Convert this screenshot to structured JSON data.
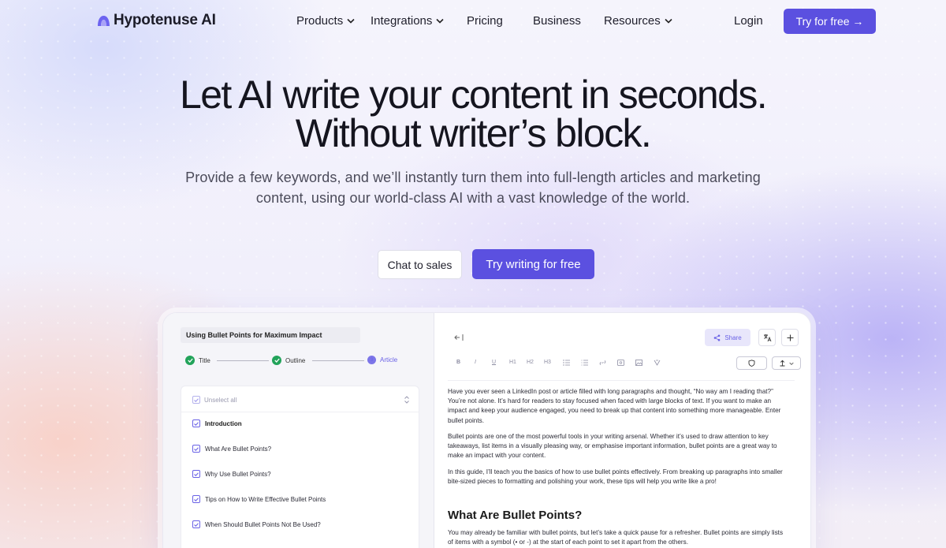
{
  "nav": {
    "brand": "Hypotenuse AI",
    "items": [
      {
        "label": "Products",
        "dropdown": true
      },
      {
        "label": "Integrations",
        "dropdown": true
      },
      {
        "label": "Pricing",
        "dropdown": false
      },
      {
        "label": "Business",
        "dropdown": false
      },
      {
        "label": "Resources",
        "dropdown": true
      }
    ],
    "login": "Login",
    "cta": "Try for free →"
  },
  "hero": {
    "headline_line1": "Let AI write your content in seconds.",
    "headline_line2": "Without writer’s block.",
    "sub_line1": "Provide a few keywords, and we’ll instantly turn them into full-length articles and marketing",
    "sub_line2": "content, using our world-class AI with a vast knowledge of the world.",
    "btn_sales": "Chat to sales",
    "btn_try": "Try writing for free"
  },
  "mockup": {
    "doc_title": "Using Bullet Points for Maximum Impact",
    "steps": [
      {
        "label": "Title",
        "state": "done"
      },
      {
        "label": "Outline",
        "state": "done"
      },
      {
        "label": "Article",
        "state": "active",
        "number": "3"
      }
    ],
    "outline_header": "Unselect all",
    "outline_items": [
      {
        "label": "Introduction",
        "bold": true
      },
      {
        "label": "What Are Bullet Points?",
        "bold": false
      },
      {
        "label": "Why Use Bullet Points?",
        "bold": false
      },
      {
        "label": "Tips on How to Write Effective Bullet Points",
        "bold": false
      },
      {
        "label": "When Should Bullet Points Not Be Used?",
        "bold": false
      }
    ],
    "share_label": "Share",
    "toolbar": [
      "B",
      "I",
      "U",
      "H1",
      "H2",
      "H3",
      "list-icon",
      "ordered-list-icon",
      "link-icon",
      "table-icon",
      "image-icon",
      "format-icon"
    ],
    "paragraphs": [
      "Have you ever seen a LinkedIn post or article filled with long paragraphs and thought, “No way am I reading that?” You’re not alone. It’s hard for readers to stay focused when faced with large blocks of text. If you want to make an impact and keep your audience engaged, you need to break up that content into something more manageable. Enter bullet points.",
      "Bullet points are one of the most powerful tools in your writing arsenal. Whether it’s used to draw attention to key takeaways, list items in a visually pleasing way, or emphasise important information, bullet points are a great way to make an impact with your content.",
      "In this guide, I’ll teach you the basics of how to use bullet points effectively. From breaking up paragraphs into smaller bite-sized pieces to formatting and polishing your work, these tips will help you write like a pro!"
    ],
    "section_heading": "What Are Bullet Points?",
    "section_paragraph": "You may already be familiar with bullet points, but let’s take a quick pause for a refresher. Bullet points are simply lists of items with a symbol (• or -) at the start of each point to set it apart from the others."
  },
  "colors": {
    "accent": "#5b50e0",
    "check_green": "#22a35a",
    "share_bg": "#e8e6fb"
  }
}
